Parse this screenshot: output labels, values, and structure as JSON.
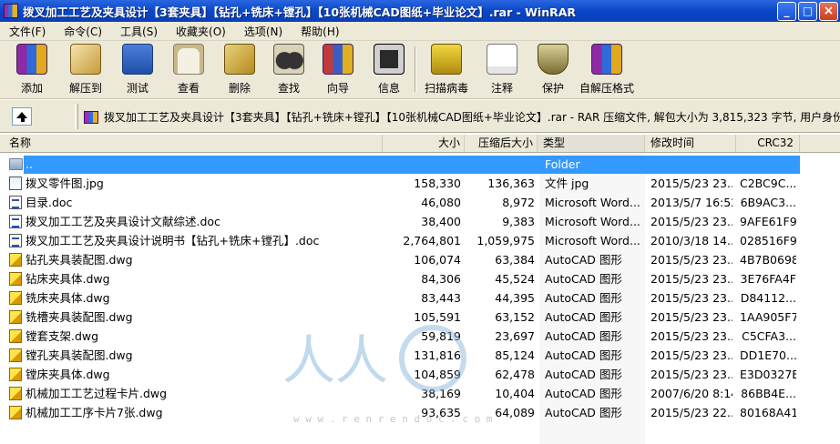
{
  "window": {
    "title": "拨叉加工工艺及夹具设计【3套夹具】【钻孔+铣床+镗孔】【10张机械CAD图纸+毕业论文】.rar - WinRAR",
    "minimize": "_",
    "maximize": "□",
    "close": "×"
  },
  "menu": [
    "文件(F)",
    "命令(C)",
    "工具(S)",
    "收藏夹(O)",
    "选项(N)",
    "帮助(H)"
  ],
  "toolbar": [
    {
      "label": "添加",
      "icon": "add-archive-icon"
    },
    {
      "label": "解压到",
      "icon": "extract-to-icon"
    },
    {
      "label": "测试",
      "icon": "test-icon"
    },
    {
      "label": "查看",
      "icon": "view-icon"
    },
    {
      "label": "删除",
      "icon": "delete-icon"
    },
    {
      "label": "查找",
      "icon": "find-icon"
    },
    {
      "label": "向导",
      "icon": "wizard-icon"
    },
    {
      "label": "信息",
      "icon": "info-icon"
    },
    {
      "label": "扫描病毒",
      "icon": "virus-scan-icon"
    },
    {
      "label": "注释",
      "icon": "comment-icon"
    },
    {
      "label": "保护",
      "icon": "protect-icon"
    },
    {
      "label": "自解压格式",
      "icon": "sfx-icon"
    }
  ],
  "address": {
    "text": "拨叉加工工艺及夹具设计【3套夹具】【钻孔+铣床+镗孔】【10张机械CAD图纸+毕业论文】.rar - RAR 压缩文件, 解包大小为 3,815,323 字节, 用户身份"
  },
  "columns": {
    "name": "名称",
    "size": "大小",
    "packed": "压缩后大小",
    "type": "类型",
    "modified": "修改时间",
    "crc": "CRC32"
  },
  "rows": [
    {
      "name": "..",
      "size": "",
      "packed": "",
      "type": "Folder",
      "modified": "",
      "crc": "",
      "kind": "folder"
    },
    {
      "name": "拨叉零件图.jpg",
      "size": "158,330",
      "packed": "136,363",
      "type": "文件 jpg",
      "modified": "2015/5/23 23...",
      "crc": "C2BC9C...",
      "kind": "jpg"
    },
    {
      "name": "目录.doc",
      "size": "46,080",
      "packed": "8,972",
      "type": "Microsoft Word...",
      "modified": "2013/5/7 16:52",
      "crc": "6B9AC3...",
      "kind": "doc"
    },
    {
      "name": "拨叉加工工艺及夹具设计文献综述.doc",
      "size": "38,400",
      "packed": "9,383",
      "type": "Microsoft Word...",
      "modified": "2015/5/23 23...",
      "crc": "9AFE61F9",
      "kind": "doc"
    },
    {
      "name": "拨叉加工工艺及夹具设计说明书【钻孔+铣床+镗孔】.doc",
      "size": "2,764,801",
      "packed": "1,059,975",
      "type": "Microsoft Word...",
      "modified": "2010/3/18 14...",
      "crc": "028516F9",
      "kind": "doc"
    },
    {
      "name": "钻孔夹具装配图.dwg",
      "size": "106,074",
      "packed": "63,384",
      "type": "AutoCAD 图形",
      "modified": "2015/5/23 23...",
      "crc": "4B7B0698",
      "kind": "dwg"
    },
    {
      "name": "钻床夹具体.dwg",
      "size": "84,306",
      "packed": "45,524",
      "type": "AutoCAD 图形",
      "modified": "2015/5/23 23...",
      "crc": "3E76FA4F",
      "kind": "dwg"
    },
    {
      "name": "铣床夹具体.dwg",
      "size": "83,443",
      "packed": "44,395",
      "type": "AutoCAD 图形",
      "modified": "2015/5/23 23...",
      "crc": "D84112...",
      "kind": "dwg"
    },
    {
      "name": "铣槽夹具装配图.dwg",
      "size": "105,591",
      "packed": "63,152",
      "type": "AutoCAD 图形",
      "modified": "2015/5/23 23...",
      "crc": "1AA905F7",
      "kind": "dwg"
    },
    {
      "name": "镗套支架.dwg",
      "size": "59,819",
      "packed": "23,697",
      "type": "AutoCAD 图形",
      "modified": "2015/5/23 23...",
      "crc": "C5CFA3...",
      "kind": "dwg"
    },
    {
      "name": "镗孔夹具装配图.dwg",
      "size": "131,816",
      "packed": "85,124",
      "type": "AutoCAD 图形",
      "modified": "2015/5/23 23...",
      "crc": "DD1E70...",
      "kind": "dwg"
    },
    {
      "name": "镗床夹具体.dwg",
      "size": "104,859",
      "packed": "62,478",
      "type": "AutoCAD 图形",
      "modified": "2015/5/23 23...",
      "crc": "E3D0327E",
      "kind": "dwg"
    },
    {
      "name": "机械加工工艺过程卡片.dwg",
      "size": "38,169",
      "packed": "10,404",
      "type": "AutoCAD 图形",
      "modified": "2007/6/20 8:14",
      "crc": "86BB4E...",
      "kind": "dwg"
    },
    {
      "name": "机械加工工序卡片7张.dwg",
      "size": "93,635",
      "packed": "64,089",
      "type": "AutoCAD 图形",
      "modified": "2015/5/23 22...",
      "crc": "80168A41",
      "kind": "dwg"
    }
  ],
  "watermark": {
    "chars": "人人",
    "url": "w w w . r e n r e n d o c . c o m"
  },
  "colors": {
    "selection": "#3399ff",
    "titlebar": "#0a47c8",
    "chrome": "#ece9d8"
  }
}
